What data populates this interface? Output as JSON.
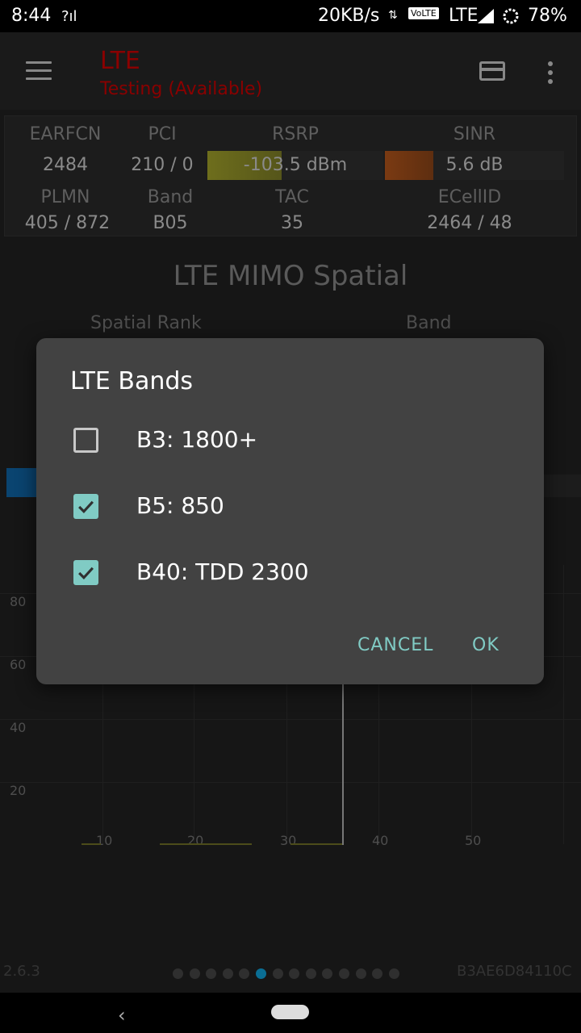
{
  "status": {
    "time": "8:44",
    "speed": "20KB/s",
    "network": "LTE",
    "battery": "78%",
    "volte": "VoLTE"
  },
  "app_bar": {
    "title": "LTE",
    "subtitle": "Testing (Available)"
  },
  "info": {
    "earfcn_label": "EARFCN",
    "earfcn": "2484",
    "pci_label": "PCI",
    "pci": "210 / 0",
    "rsrp_label": "RSRP",
    "rsrp": "-103.5 dBm",
    "rsrp_level": 0.42,
    "sinr_label": "SINR",
    "sinr": "5.6 dB",
    "sinr_level": 0.27,
    "plmn_label": "PLMN",
    "plmn": "405 / 872",
    "band_label": "Band",
    "band": "B05",
    "tac_label": "TAC",
    "tac": "35",
    "ecellid_label": "ECellID",
    "ecellid": "2464 / 48"
  },
  "chart": {
    "title": "LTE MIMO Spatial",
    "spatial_rank_label": "Spatial Rank",
    "band_label": "Band",
    "y_ticks": [
      "80",
      "60",
      "40",
      "20"
    ],
    "x_ticks": [
      "10",
      "20",
      "30",
      "40",
      "50"
    ]
  },
  "footer": {
    "version": "2.6.3",
    "device_id": "B3AE6D84110C"
  },
  "dialog": {
    "title": "LTE Bands",
    "options": [
      {
        "label": "B3: 1800+",
        "checked": false
      },
      {
        "label": "B5: 850",
        "checked": true
      },
      {
        "label": "B40: TDD 2300",
        "checked": true
      }
    ],
    "cancel_label": "CANCEL",
    "ok_label": "OK"
  },
  "colors": {
    "accent": "#80cbc4",
    "title_red": "#8a0000",
    "rsrp_bar": "#6e6e1c",
    "sinr_bar": "#7a3a12",
    "active_dot": "#0a6e94"
  },
  "icons": [
    "menu-icon",
    "card-icon",
    "more-icon",
    "back-arrow-icon",
    "home-pill-icon",
    "check-icon"
  ]
}
